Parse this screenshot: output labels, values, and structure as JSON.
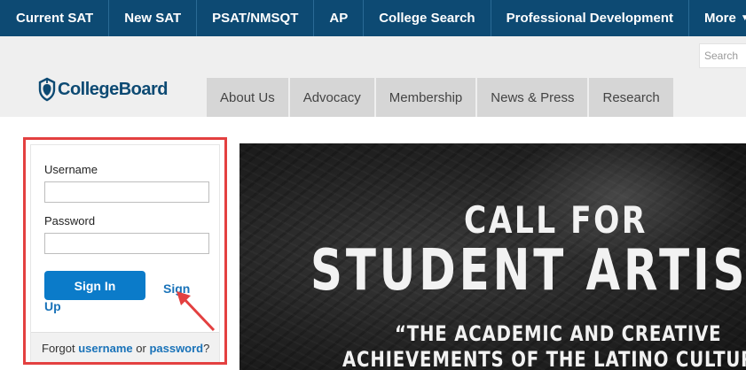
{
  "top_nav": {
    "items": [
      "Current SAT",
      "New SAT",
      "PSAT/NMSQT",
      "AP",
      "College Search",
      "Professional Development"
    ],
    "more_label": "More",
    "more_icon": "chevron-down-icon"
  },
  "search": {
    "placeholder": "Search"
  },
  "logo": {
    "text": "CollegeBoard",
    "icon": "acorn-shield-icon"
  },
  "sub_nav": {
    "items": [
      "About Us",
      "Advocacy",
      "Membership",
      "News & Press",
      "Research"
    ]
  },
  "login": {
    "username_label": "Username",
    "username_value": "",
    "password_label": "Password",
    "password_value": "",
    "sign_in_label": "Sign In",
    "sign_up_word1": "Sign",
    "sign_up_word2": "Up",
    "forgot_prefix": "Forgot",
    "forgot_username": "username",
    "forgot_or": "or",
    "forgot_password": "password",
    "forgot_suffix": "?"
  },
  "hero": {
    "line1": "CALL FOR",
    "line2": "STUDENT ARTIST",
    "line3": "“THE ACADEMIC AND CREATIVE",
    "line4": "ACHIEVEMENTS OF THE LATINO CULTURE"
  },
  "colors": {
    "nav_bg": "#0d4a73",
    "accent": "#0b7bc9",
    "highlight_box": "#e34040",
    "link": "#1a73b9"
  }
}
